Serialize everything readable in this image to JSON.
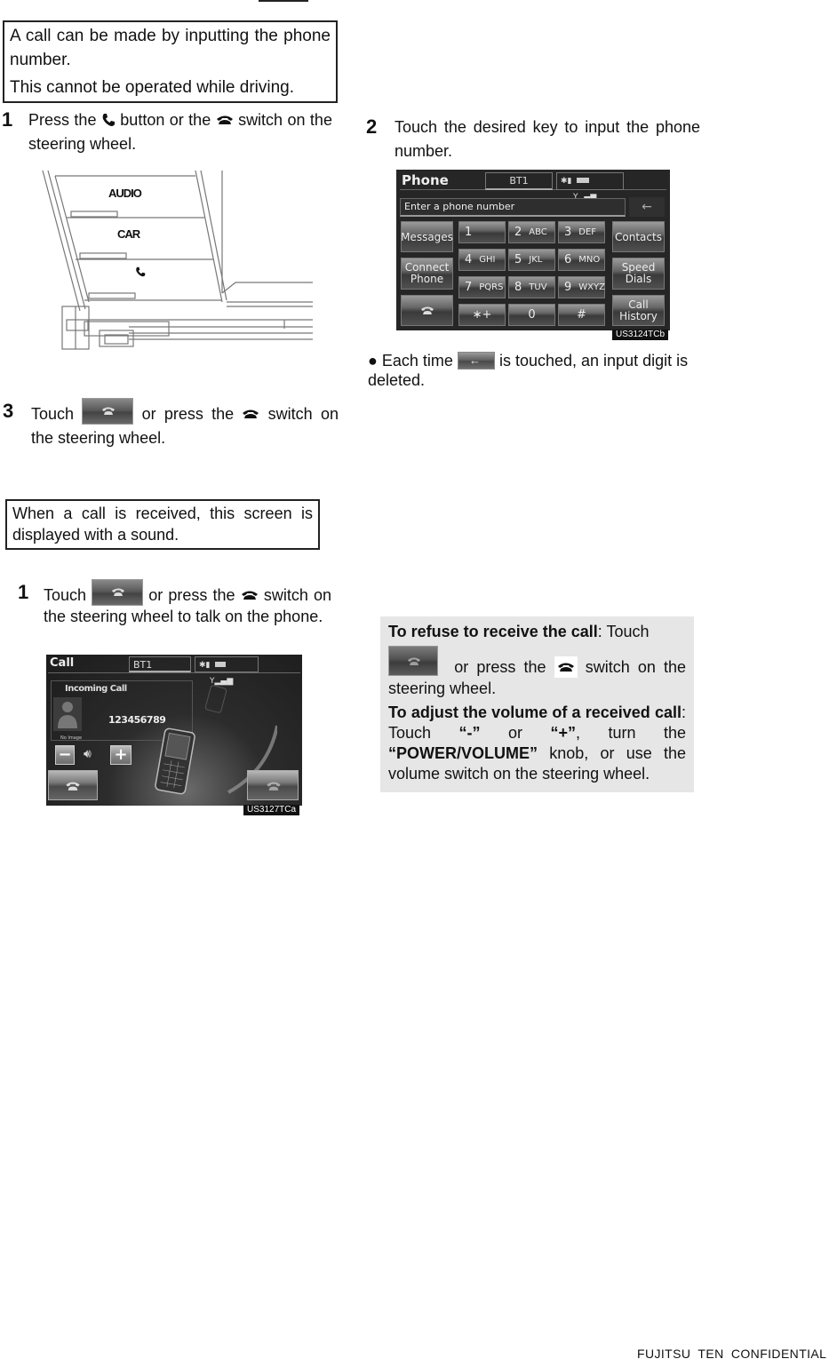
{
  "page": {
    "footer": "FUJITSU  TEN  CONFIDENTIAL"
  },
  "section_make_call": {
    "intro_line1": "A call can be made by inputting the phone number.",
    "intro_line2": "This cannot be operated while driving.",
    "steps": [
      {
        "num": "1",
        "text_a": "Press the",
        "text_b": "button or the",
        "text_c": "switch on the steering wheel."
      },
      {
        "num": "2",
        "text": "Touch the desired key to input the phone number."
      },
      {
        "num": "3",
        "text_a": "Touch",
        "text_b": "or press the",
        "text_c": "switch on the steering wheel."
      }
    ],
    "bullet_note": {
      "text_a": "Each time",
      "text_b": "is touched, an input digit is deleted."
    }
  },
  "panel_illustration": {
    "buttons": [
      "AUDIO",
      "CAR"
    ],
    "phone_button_icon": "handset-icon"
  },
  "phone_screen": {
    "title": "Phone",
    "tab": "BT1",
    "status": {
      "bluetooth": "bluetooth-icon",
      "battery": "battery-icon",
      "signal": "signal-icon"
    },
    "input_placeholder": "Enter a phone number",
    "back_label": "←",
    "left_buttons": [
      "Messages",
      "Connect Phone"
    ],
    "right_buttons": [
      "Contacts",
      "Speed Dials",
      "Call History"
    ],
    "keys": [
      {
        "digit": "1",
        "letters": ""
      },
      {
        "digit": "2",
        "letters": "ABC"
      },
      {
        "digit": "3",
        "letters": "DEF"
      },
      {
        "digit": "4",
        "letters": "GHI"
      },
      {
        "digit": "5",
        "letters": "JKL"
      },
      {
        "digit": "6",
        "letters": "MNO"
      },
      {
        "digit": "7",
        "letters": "PQRS"
      },
      {
        "digit": "8",
        "letters": "TUV"
      },
      {
        "digit": "9",
        "letters": "WXYZ"
      },
      {
        "digit": "∗+",
        "letters": ""
      },
      {
        "digit": "0",
        "letters": ""
      },
      {
        "digit": "#",
        "letters": ""
      }
    ],
    "caption": "US3124TCb"
  },
  "section_receive_call": {
    "intro": "When a call is received, this screen is displayed with a sound.",
    "step": {
      "num": "1",
      "text_a": "Touch",
      "text_b": "or press the",
      "text_c": "switch on the steering wheel to talk on the phone."
    }
  },
  "call_screen": {
    "title": "Call",
    "tab": "BT1",
    "incoming_label": "Incoming Call",
    "number": "123456789",
    "no_image_label": "No Image",
    "minus": "−",
    "plus": "+",
    "caption": "US3127TCa"
  },
  "note_box": {
    "refuse_bold": "To refuse to receive the call",
    "refuse_a": ": Touch",
    "refuse_b": "or press the",
    "refuse_c": "switch on the steering wheel.",
    "volume_bold": "To adjust the volume of a received call",
    "volume_a": ": Touch ",
    "minus_q": "“-”",
    "or": " or ",
    "plus_q": "“+”",
    "volume_b": ", turn the ",
    "knob_q": "“POWER/VOLUME”",
    "volume_c": " knob, or use the volume switch on the steering wheel."
  }
}
